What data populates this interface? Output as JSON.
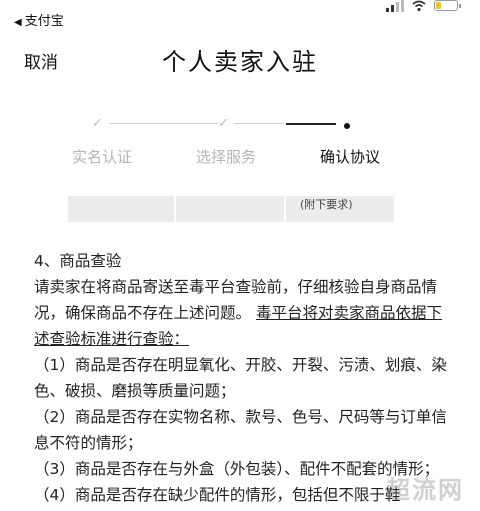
{
  "status_bar": {
    "back_app": "支付宝"
  },
  "nav": {
    "cancel": "取消",
    "title": "个人卖家入驻"
  },
  "steps": [
    {
      "label": "实名认证",
      "state": "done"
    },
    {
      "label": "选择服务",
      "state": "done"
    },
    {
      "label": "确认协议",
      "state": "current"
    }
  ],
  "table_fragment": {
    "text": "(附下要求)"
  },
  "section": {
    "heading": "4、商品查验",
    "intro_plain": "请卖家在将商品寄送至毒平台查验前，仔细核验自身商品情况，确保商品不存在上述问题。",
    "intro_underlined": "毒平台将对卖家商品依据下述查验标准进行查验：",
    "items": [
      "（1）商品是否存在明显氧化、开胶、开裂、污渍、划痕、染色、破损、磨损等质量问题；",
      "（2）商品是否存在实物名称、款号、色号、尺码等与订单信息不符的情形；",
      "（3）商品是否存在与外盒（外包装）、配件不配套的情形；",
      "（4）商品是否存在缺少配件的情形，包括但不限于鞋"
    ]
  },
  "watermark": "超流网",
  "colors": {
    "battery": "#e4c73b",
    "inactive_step": "#b5b5b5",
    "active_step": "#111111"
  }
}
